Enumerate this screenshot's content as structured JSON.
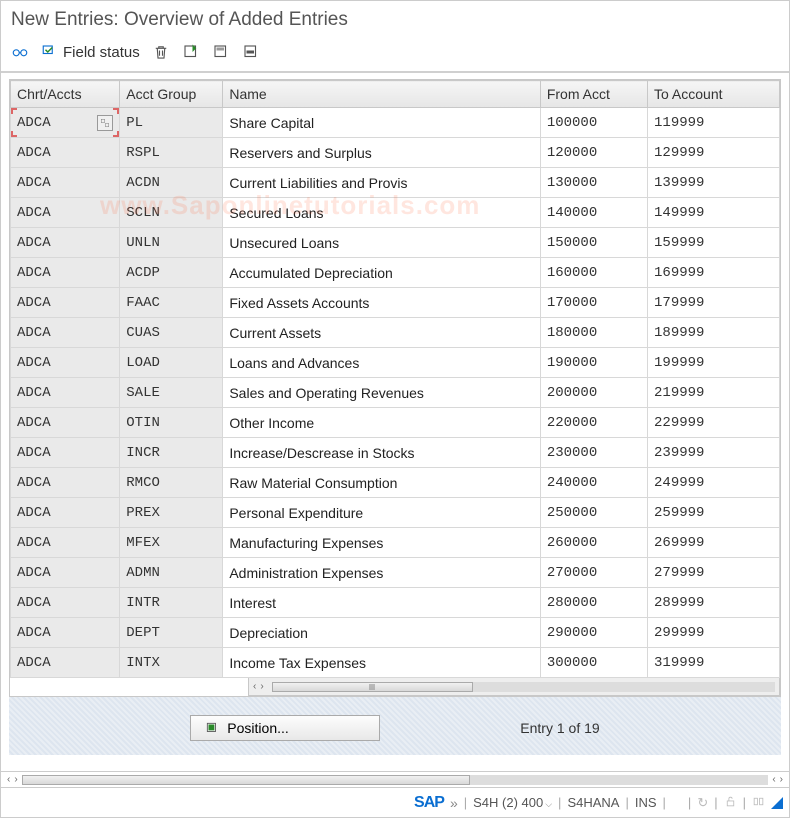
{
  "title": "New Entries: Overview of Added Entries",
  "toolbar": {
    "field_status_label": "Field status"
  },
  "columns": [
    "Chrt/Accts",
    "Acct Group",
    "Name",
    "From Acct",
    "To Account"
  ],
  "rows": [
    {
      "chart": "ADCA",
      "group": "PL",
      "name": "Share Capital",
      "from": "100000",
      "to": "119999"
    },
    {
      "chart": "ADCA",
      "group": "RSPL",
      "name": "Reservers and Surplus",
      "from": "120000",
      "to": "129999"
    },
    {
      "chart": "ADCA",
      "group": "ACDN",
      "name": "Current Liabilities and Provis",
      "from": "130000",
      "to": "139999"
    },
    {
      "chart": "ADCA",
      "group": "SCLN",
      "name": "Secured Loans",
      "from": "140000",
      "to": "149999"
    },
    {
      "chart": "ADCA",
      "group": "UNLN",
      "name": "Unsecured Loans",
      "from": "150000",
      "to": "159999"
    },
    {
      "chart": "ADCA",
      "group": "ACDP",
      "name": "Accumulated Depreciation",
      "from": "160000",
      "to": "169999"
    },
    {
      "chart": "ADCA",
      "group": "FAAC",
      "name": "Fixed Assets Accounts",
      "from": "170000",
      "to": "179999"
    },
    {
      "chart": "ADCA",
      "group": "CUAS",
      "name": "Current Assets",
      "from": "180000",
      "to": "189999"
    },
    {
      "chart": "ADCA",
      "group": "LOAD",
      "name": "Loans and Advances",
      "from": "190000",
      "to": "199999"
    },
    {
      "chart": "ADCA",
      "group": "SALE",
      "name": "Sales and Operating Revenues",
      "from": "200000",
      "to": "219999"
    },
    {
      "chart": "ADCA",
      "group": "OTIN",
      "name": "Other Income",
      "from": "220000",
      "to": "229999"
    },
    {
      "chart": "ADCA",
      "group": "INCR",
      "name": "Increase/Descrease in Stocks",
      "from": "230000",
      "to": "239999"
    },
    {
      "chart": "ADCA",
      "group": "RMCO",
      "name": "Raw Material Consumption",
      "from": "240000",
      "to": "249999"
    },
    {
      "chart": "ADCA",
      "group": "PREX",
      "name": "Personal Expenditure",
      "from": "250000",
      "to": "259999"
    },
    {
      "chart": "ADCA",
      "group": "MFEX",
      "name": "Manufacturing Expenses",
      "from": "260000",
      "to": "269999"
    },
    {
      "chart": "ADCA",
      "group": "ADMN",
      "name": "Administration Expenses",
      "from": "270000",
      "to": "279999"
    },
    {
      "chart": "ADCA",
      "group": "INTR",
      "name": "Interest",
      "from": "280000",
      "to": "289999"
    },
    {
      "chart": "ADCA",
      "group": "DEPT",
      "name": "Depreciation",
      "from": "290000",
      "to": "299999"
    },
    {
      "chart": "ADCA",
      "group": "INTX",
      "name": "Income Tax Expenses",
      "from": "300000",
      "to": "319999"
    }
  ],
  "position_button": "Position...",
  "entry_count": "Entry 1 of 19",
  "status": {
    "sap": "SAP",
    "system": "S4H (2) 400",
    "server": "S4HANA",
    "mode": "INS"
  },
  "watermark": "www.Saponlinetutorials.com"
}
